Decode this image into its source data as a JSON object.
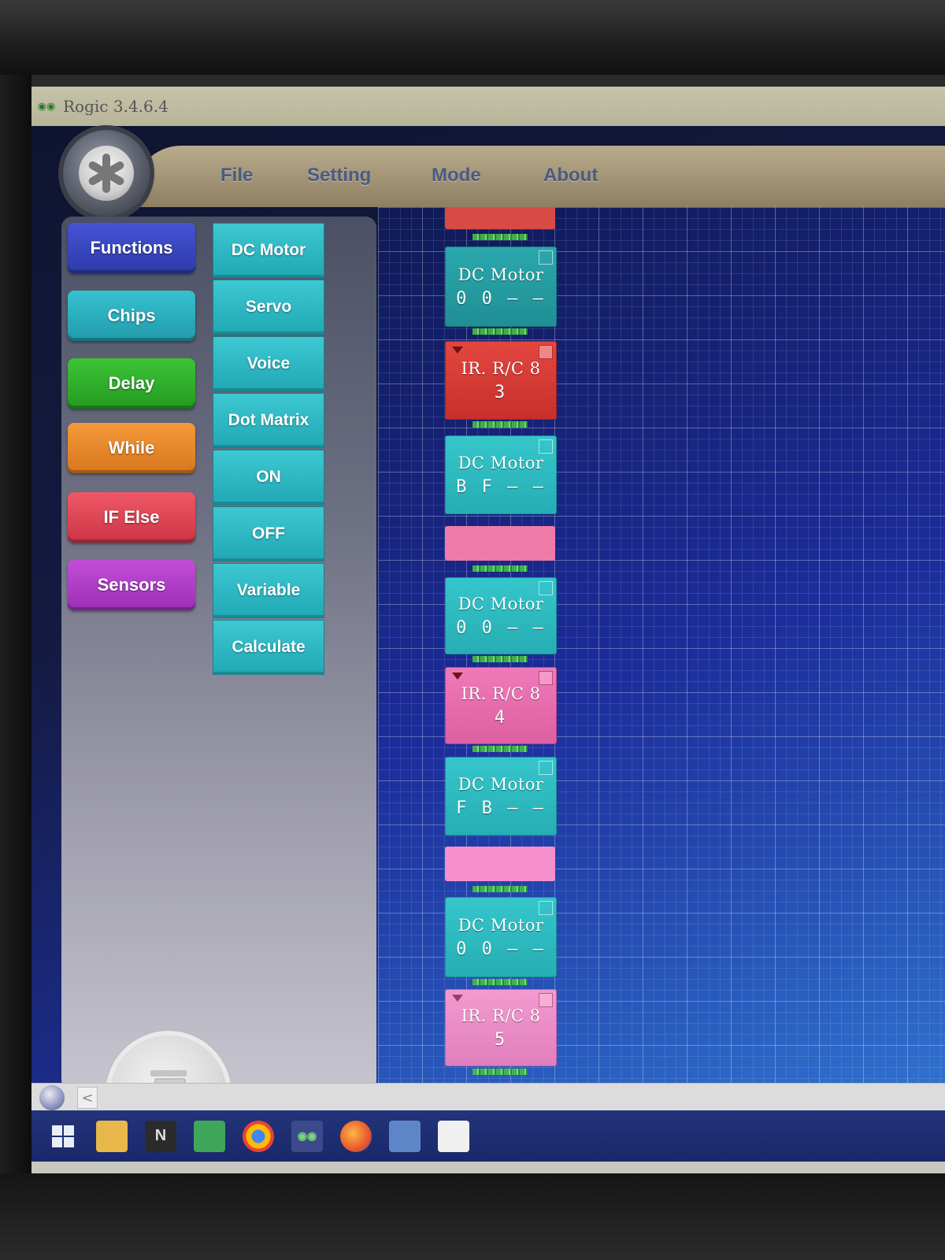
{
  "window": {
    "title": "Rogic 3.4.6.4",
    "logo_icon": "rogic-app-icon"
  },
  "menu": {
    "items": [
      "File",
      "Setting",
      "Mode",
      "About"
    ]
  },
  "categories": [
    {
      "label": "Functions",
      "color": "#3b49c7"
    },
    {
      "label": "Chips",
      "color": "#2bb2c2"
    },
    {
      "label": "Delay",
      "color": "#2fae2a"
    },
    {
      "label": "While",
      "color": "#ec8a2c"
    },
    {
      "label": "IF Else",
      "color": "#e3485a"
    },
    {
      "label": "Sensors",
      "color": "#b640cc"
    }
  ],
  "chips": [
    "DC Motor",
    "Servo",
    "Voice",
    "Dot Matrix",
    "ON",
    "OFF",
    "Variable",
    "Calculate"
  ],
  "program_blocks": [
    {
      "type": "bar",
      "color": "red"
    },
    {
      "type": "dc_motor",
      "name": "DC Motor",
      "value": "0 0 — —",
      "style": "teal"
    },
    {
      "type": "ir",
      "name": "IR. R/C 8",
      "value": "3",
      "style": "red"
    },
    {
      "type": "dc_motor",
      "name": "DC Motor",
      "value": "B F — —",
      "style": "cyan"
    },
    {
      "type": "bar",
      "color": "pink"
    },
    {
      "type": "dc_motor",
      "name": "DC Motor",
      "value": "0 0 — —",
      "style": "cyan"
    },
    {
      "type": "ir",
      "name": "IR. R/C 8",
      "value": "4",
      "style": "pink"
    },
    {
      "type": "dc_motor",
      "name": "DC Motor",
      "value": "F B — —",
      "style": "cyan"
    },
    {
      "type": "bar",
      "color": "pinklt"
    },
    {
      "type": "dc_motor",
      "name": "DC Motor",
      "value": "0 0 — —",
      "style": "cyan"
    },
    {
      "type": "ir",
      "name": "IR. R/C 8",
      "value": "5",
      "style": "pinklt"
    }
  ],
  "trash": {
    "icon": "trash-icon"
  },
  "scrollbar": {
    "left_arrow": "<"
  },
  "taskbar": {
    "icons": [
      "windows-start-icon",
      "file-explorer-icon",
      "inkscape-icon",
      "store-icon",
      "chrome-icon",
      "rogic-icon",
      "firefox-icon",
      "settings-icon",
      "notepad-icon"
    ]
  }
}
